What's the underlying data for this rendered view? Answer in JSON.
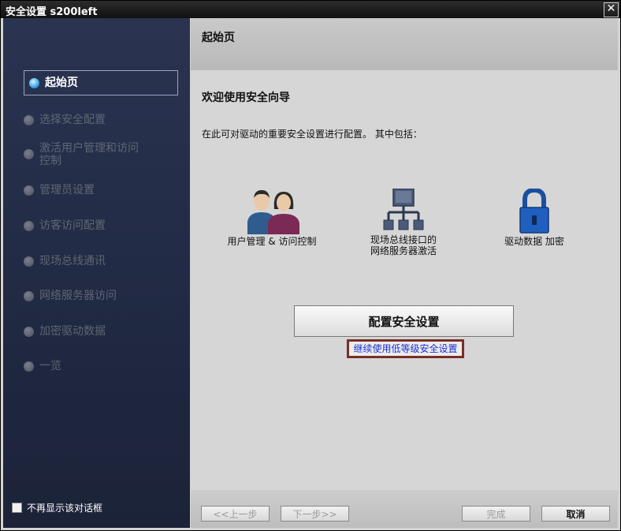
{
  "window": {
    "title": "安全设置 s200left",
    "close_symbol": "✕"
  },
  "sidebar": {
    "items": [
      {
        "label": "起始页",
        "active": true
      },
      {
        "label": "选择安全配置"
      },
      {
        "label": "激活用户管理和访问控制"
      },
      {
        "label": "管理员设置"
      },
      {
        "label": "访客访问配置"
      },
      {
        "label": "现场总线通讯"
      },
      {
        "label": "网络服务器访问"
      },
      {
        "label": "加密驱动数据"
      },
      {
        "label": "一览"
      }
    ],
    "dont_show_label": "不再显示该对话框"
  },
  "header": {
    "title": "起始页"
  },
  "main": {
    "welcome": "欢迎使用安全向导",
    "description": "在此可对驱动的重要安全设置进行配置。 其中包括：",
    "features": [
      {
        "icon": "users-icon",
        "label": "用户管理 & 访问控制"
      },
      {
        "icon": "network-icon",
        "label": "现场总线接口的\n网络服务器激活"
      },
      {
        "icon": "lock-icon",
        "label": "驱动数据 加密"
      }
    ],
    "configure_button": "配置安全设置",
    "low_security_link": "继续使用低等级安全设置"
  },
  "footer": {
    "prev": "<<上一步",
    "next": "下一步>>",
    "finish": "完成",
    "cancel": "取消"
  },
  "colors": {
    "sidebar_bg": "#222a40",
    "active_dot": "#3aa4e8",
    "link": "#1a2fd6",
    "link_border": "#7a2d24"
  }
}
